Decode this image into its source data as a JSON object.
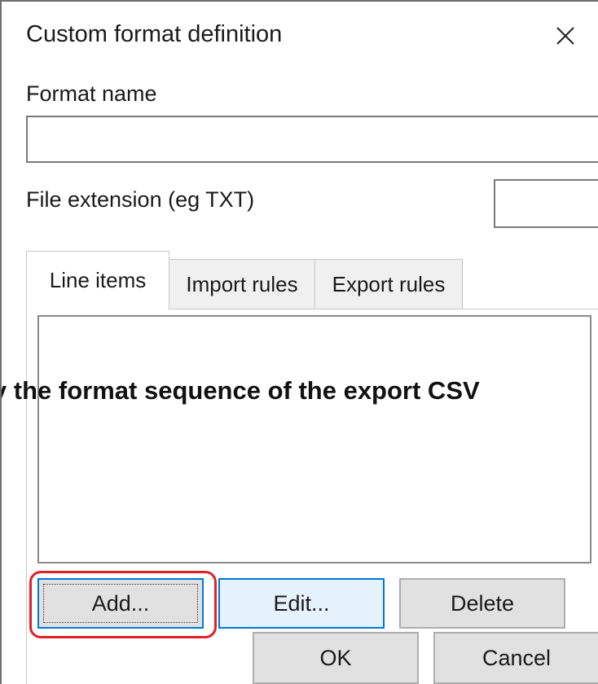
{
  "window": {
    "title": "Custom format definition",
    "close_icon": "close-icon"
  },
  "fields": {
    "format_name_label": "Format name",
    "format_name_value": "",
    "file_extension_label": "File extension (eg TXT)",
    "file_extension_value": ""
  },
  "tabs": [
    {
      "label": "Line items",
      "active": true
    },
    {
      "label": "Import rules",
      "active": false
    },
    {
      "label": "Export rules",
      "active": false
    }
  ],
  "line_items_list": [],
  "overlay_caption": "ify the format sequence of the export CSV",
  "buttons": {
    "add": "Add...",
    "edit": "Edit...",
    "delete": "Delete",
    "ok": "OK",
    "cancel": "Cancel"
  },
  "colors": {
    "highlight": "#e0202a",
    "focus_border": "#0078d7"
  }
}
